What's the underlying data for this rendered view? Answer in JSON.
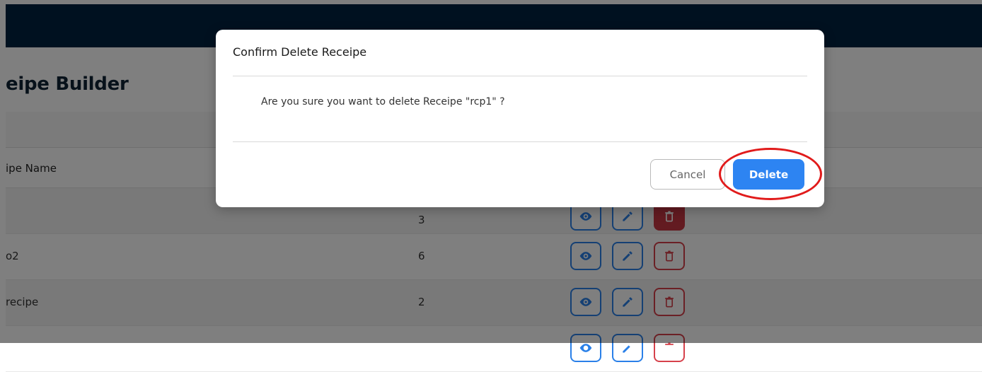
{
  "page": {
    "title": "eipe Builder",
    "column_header_name": "ipe Name"
  },
  "rows": [
    {
      "name": "",
      "count": "3"
    },
    {
      "name": "o2",
      "count": "6"
    },
    {
      "name": "recipe",
      "count": "2"
    },
    {
      "name": "",
      "count": ""
    }
  ],
  "dialog": {
    "title": "Confirm Delete Receipe",
    "message": "Are you sure you want to delete Receipe \"rcp1\" ?",
    "cancel_label": "Cancel",
    "delete_label": "Delete"
  },
  "colors": {
    "topbar": "#012340",
    "primary": "#2d84f2",
    "danger": "#c73742",
    "highlight": "#e11b1b"
  },
  "icons": {
    "view": "eye-icon",
    "edit": "pencil-icon",
    "delete": "trash-icon"
  }
}
